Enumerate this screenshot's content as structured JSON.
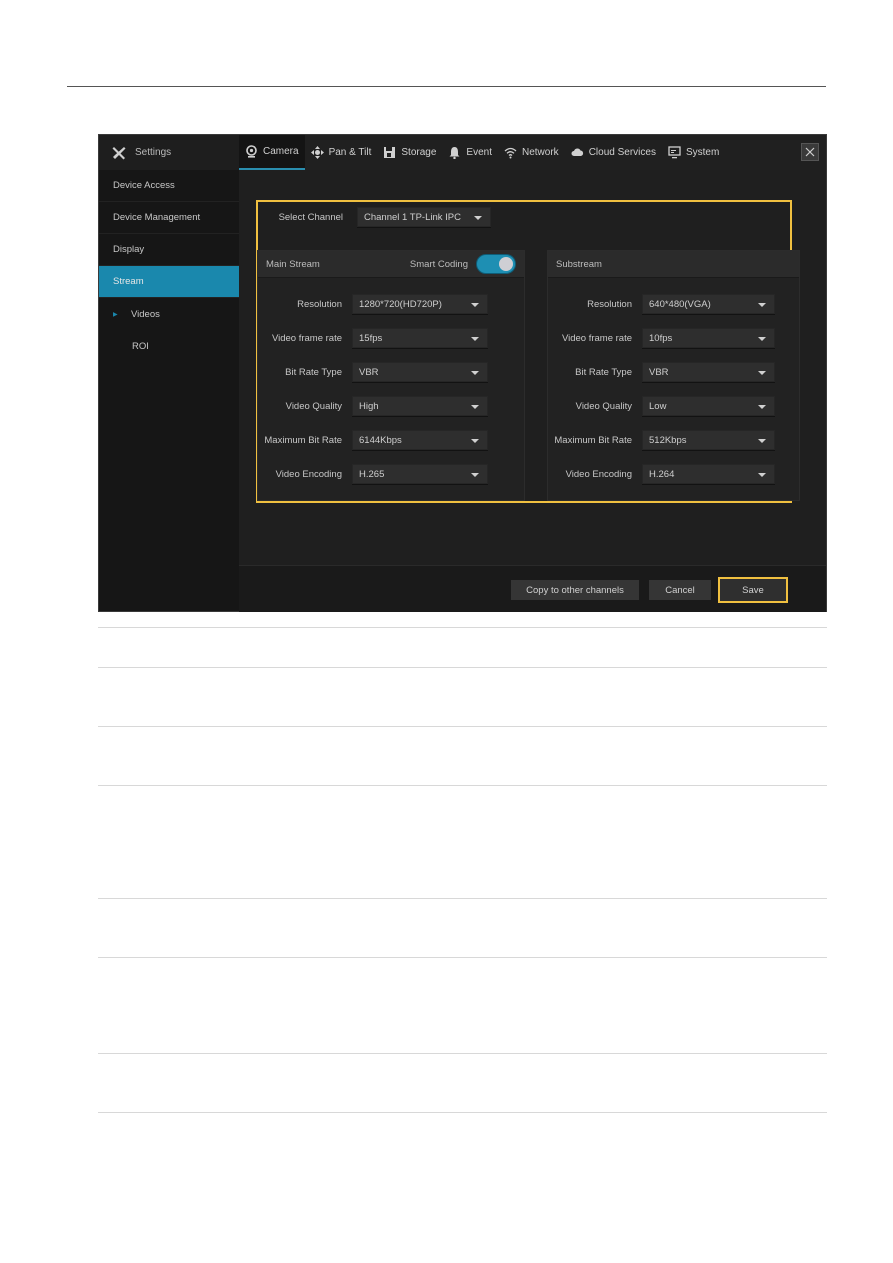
{
  "app": {
    "settings_title": "Settings",
    "tabs": [
      {
        "label": "Camera",
        "icon": "camera-icon",
        "active": true
      },
      {
        "label": "Pan & Tilt",
        "icon": "pan-tilt-icon",
        "active": false
      },
      {
        "label": "Storage",
        "icon": "storage-icon",
        "active": false
      },
      {
        "label": "Event",
        "icon": "bell-icon",
        "active": false
      },
      {
        "label": "Network",
        "icon": "wifi-icon",
        "active": false
      },
      {
        "label": "Cloud Services",
        "icon": "cloud-icon",
        "active": false
      },
      {
        "label": "System",
        "icon": "monitor-icon",
        "active": false
      }
    ],
    "close_icon": "close-icon"
  },
  "sidebar": {
    "items": [
      {
        "label": "Device Access"
      },
      {
        "label": "Device Management"
      },
      {
        "label": "Display"
      },
      {
        "label": "Stream",
        "active": true
      }
    ],
    "subitems": [
      {
        "label": "Videos",
        "active": true
      },
      {
        "label": "ROI"
      }
    ]
  },
  "channel": {
    "label": "Select Channel",
    "value": "Channel 1 TP-Link IPC"
  },
  "main_stream": {
    "title": "Main Stream",
    "smart_coding_label": "Smart Coding",
    "smart_coding_on": true,
    "fields": [
      {
        "label": "Resolution",
        "value": "1280*720(HD720P)"
      },
      {
        "label": "Video frame rate",
        "value": "15fps"
      },
      {
        "label": "Bit Rate Type",
        "value": "VBR"
      },
      {
        "label": "Video Quality",
        "value": "High"
      },
      {
        "label": "Maximum Bit Rate",
        "value": "6144Kbps"
      },
      {
        "label": "Video Encoding",
        "value": "H.265"
      }
    ]
  },
  "substream": {
    "title": "Substream",
    "fields": [
      {
        "label": "Resolution",
        "value": "640*480(VGA)"
      },
      {
        "label": "Video frame rate",
        "value": "10fps"
      },
      {
        "label": "Bit Rate Type",
        "value": "VBR"
      },
      {
        "label": "Video Quality",
        "value": "Low"
      },
      {
        "label": "Maximum Bit Rate",
        "value": "512Kbps"
      },
      {
        "label": "Video Encoding",
        "value": "H.264"
      }
    ]
  },
  "footer": {
    "copy_label": "Copy to other channels",
    "cancel_label": "Cancel",
    "save_label": "Save"
  },
  "colors": {
    "accent": "#1a88ad",
    "highlight": "#f0c040"
  }
}
